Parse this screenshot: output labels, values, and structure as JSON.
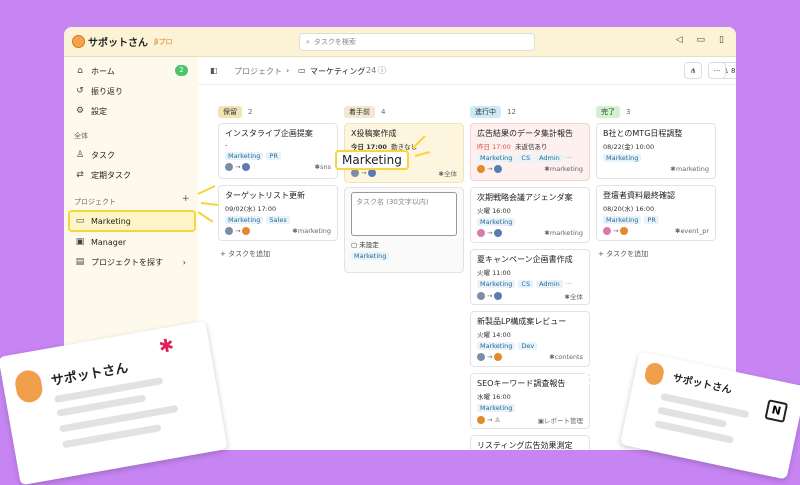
{
  "app": {
    "brand": "サポットさん",
    "plan": "βプロ",
    "search_placeholder": "タスクを検索"
  },
  "sidebar": {
    "home": "ホーム",
    "home_badge": "2",
    "review": "振り返り",
    "settings": "設定",
    "section_all": "全体",
    "tasks": "タスク",
    "recurring": "定期タスク",
    "section_projects": "プロジェクト",
    "projects": [
      "Marketing",
      "Manager"
    ],
    "find_project": "プロジェクトを探す"
  },
  "header": {
    "crumb_root": "プロジェクト",
    "crumb_current": "マーケティング",
    "count": "24",
    "members": "8"
  },
  "columns": [
    {
      "label": "保留",
      "count": "2",
      "color": "#f2e2b6"
    },
    {
      "label": "着手前",
      "count": "4",
      "color": "#f3e9cf"
    },
    {
      "label": "進行中",
      "count": "12",
      "color": "#cdeaf7"
    },
    {
      "label": "完了",
      "count": "3",
      "color": "#d3f1d0"
    }
  ],
  "cards": {
    "c1": {
      "title": "インスタライブ企画提案",
      "date": "-",
      "tags": [
        "Marketing",
        "PR"
      ],
      "channel": "sns"
    },
    "c2": {
      "title": "ターゲットリスト更新",
      "date": "09/02(水) 17:00",
      "tags": [
        "Marketing",
        "Sales"
      ],
      "channel": "marketing"
    },
    "c3": {
      "title": "X投稿案作成",
      "date": "今日 17:00",
      "status": "動きなし",
      "channel": "全体"
    },
    "c4": {
      "placeholder": "タスク名 (30文字以内)",
      "date": "未設定",
      "tags": [
        "Marketing"
      ]
    },
    "c5": {
      "title": "広告結果のデータ集計報告",
      "date": "昨日 17:00",
      "status": "未返信あり",
      "tags": [
        "Marketing",
        "CS",
        "Admin",
        "···"
      ],
      "channel": "marketing"
    },
    "c6": {
      "title": "次期戦略会議アジェンダ案",
      "date": "火曜 16:00",
      "tags": [
        "Marketing"
      ],
      "channel": "marketing"
    },
    "c7": {
      "title": "夏キャンペーン企画書作成",
      "date": "火曜 11:00",
      "tags": [
        "Marketing",
        "CS",
        "Admin",
        "···"
      ],
      "channel": "全体"
    },
    "c8": {
      "title": "新製品LP構成案レビュー",
      "date": "火曜 14:00",
      "tags": [
        "Marketing",
        "Dev"
      ],
      "channel": "contents"
    },
    "c9": {
      "title": "SEOキーワード調査報告",
      "date": "水曜 16:00",
      "tags": [
        "Marketing"
      ],
      "channel": "レポート管理"
    },
    "c10": {
      "title": "リスティング広告効果測定",
      "date": "",
      "tags": [],
      "channel": ""
    },
    "c11": {
      "title": "B社とのMTG日程調整",
      "date": "08/22(金) 10:00",
      "tags": [
        "Marketing"
      ],
      "channel": "marketing"
    },
    "c12": {
      "title": "登壇者資料最終確認",
      "date": "08/20(水) 16:00",
      "tags": [
        "Marketing",
        "PR"
      ],
      "channel": "event_pr"
    }
  },
  "add_task": "タスクを追加",
  "callout": "Marketing",
  "promo": {
    "left_title": "サポットさん",
    "right_title": "サポットさん"
  }
}
